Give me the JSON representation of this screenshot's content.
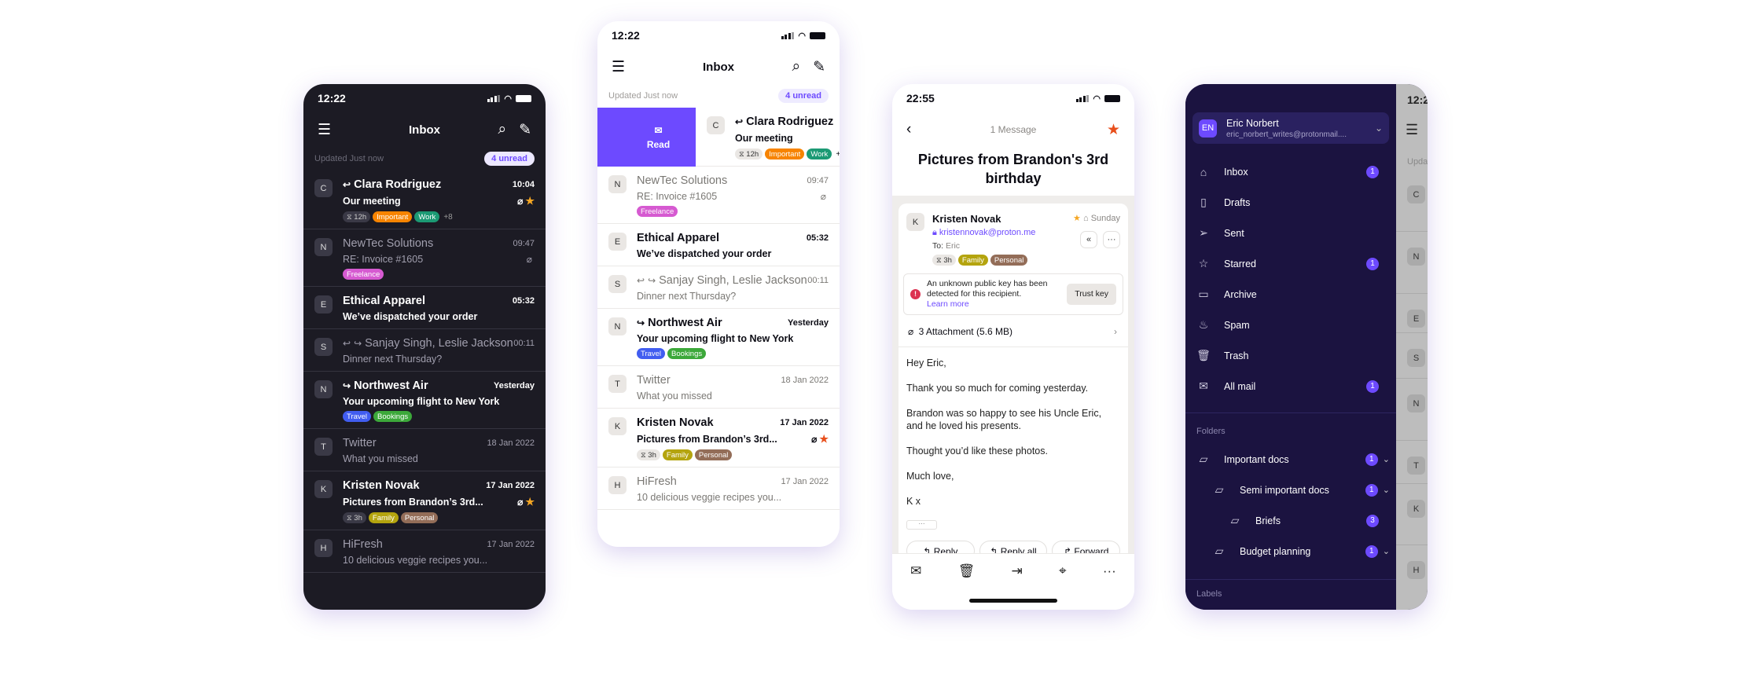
{
  "colors": {
    "accent": "#6d4aff",
    "dark_bg": "#1c1b24",
    "sidebar_bg": "#1b1340",
    "star_light": "#e84f1c",
    "star_dark": "#f5a623"
  },
  "status": {
    "time_inbox": "12:22",
    "time_message": "22:55",
    "time_partial": "12:2"
  },
  "inbox": {
    "title": "Inbox",
    "updated": "Updated Just now",
    "unread": "4 unread",
    "icons": {
      "menu": "hamburger-icon",
      "search": "search-icon",
      "compose": "compose-icon"
    },
    "swipe_action": {
      "label": "Read",
      "icon": "envelope-open-icon"
    },
    "rows": [
      {
        "initial": "C",
        "sender": "Clara Rodriguez",
        "subject": "Our meeting",
        "time": "10:04",
        "unread": true,
        "replied": true,
        "forwarded": false,
        "attachment": true,
        "starred": true,
        "expiry": "12h",
        "tags": [
          {
            "label": "Important",
            "color": "#f78400"
          },
          {
            "label": "Work",
            "color": "#1c9a74"
          }
        ],
        "more": "+8"
      },
      {
        "initial": "N",
        "sender": "NewTec Solutions",
        "subject": "RE: Invoice #1605",
        "time": "09:47",
        "unread": false,
        "replied": false,
        "forwarded": false,
        "attachment": true,
        "starred": false,
        "expiry": "",
        "tags": [
          {
            "label": "Freelance",
            "color": "#d65ad1"
          }
        ],
        "more": ""
      },
      {
        "initial": "E",
        "sender": "Ethical Apparel",
        "subject": "We’ve dispatched your order",
        "time": "05:32",
        "unread": true,
        "replied": false,
        "forwarded": false,
        "attachment": false,
        "starred": false,
        "expiry": "",
        "tags": [],
        "more": ""
      },
      {
        "initial": "S",
        "sender": "Sanjay Singh, Leslie Jackson",
        "subject": "Dinner next Thursday?",
        "time": "00:11",
        "unread": false,
        "replied": true,
        "forwarded": true,
        "attachment": false,
        "starred": false,
        "expiry": "",
        "tags": [],
        "more": ""
      },
      {
        "initial": "N",
        "sender": "Northwest Air",
        "subject": "Your upcoming flight to New York",
        "time": "Yesterday",
        "unread": true,
        "replied": false,
        "forwarded": true,
        "attachment": false,
        "starred": false,
        "expiry": "",
        "tags": [
          {
            "label": "Travel",
            "color": "#415df0"
          },
          {
            "label": "Bookings",
            "color": "#3ca83a"
          }
        ],
        "more": ""
      },
      {
        "initial": "T",
        "sender": "Twitter",
        "subject": "What you missed",
        "time": "18 Jan 2022",
        "unread": false,
        "replied": false,
        "forwarded": false,
        "attachment": false,
        "starred": false,
        "expiry": "",
        "tags": [],
        "more": ""
      },
      {
        "initial": "K",
        "sender": "Kristen Novak",
        "subject": "Pictures from Brandon’s 3rd...",
        "time": "17 Jan 2022",
        "unread": true,
        "replied": false,
        "forwarded": false,
        "attachment": true,
        "starred": true,
        "expiry": "3h",
        "tags": [
          {
            "label": "Family",
            "color": "#b4a40e"
          },
          {
            "label": "Personal",
            "color": "#936d58"
          }
        ],
        "more": ""
      },
      {
        "initial": "H",
        "sender": "HiFresh",
        "subject": "10 delicious veggie recipes you...",
        "time": "17 Jan 2022",
        "unread": false,
        "replied": false,
        "forwarded": false,
        "attachment": false,
        "starred": false,
        "expiry": "",
        "tags": [],
        "more": ""
      }
    ]
  },
  "message": {
    "count": "1 Message",
    "title": "Pictures from Brandon's 3rd birthday",
    "sender_initial": "K",
    "sender": "Kristen Novak",
    "email": "kristennovak@proton.me",
    "to_label": "To:",
    "to": "Eric",
    "date": "Sunday",
    "expiry": "3h",
    "tags": [
      {
        "label": "Family",
        "color": "#b4a40e"
      },
      {
        "label": "Personal",
        "color": "#936d58"
      }
    ],
    "warning": "An unknown public key has been detected for this recipient.",
    "learn_more": "Learn more",
    "trust_key": "Trust key",
    "attachments": "3 Attachment (5.6 MB)",
    "body": [
      "Hey Eric,",
      "Thank you so much for coming yesterday.",
      "Brandon was so happy to see his Uncle Eric,\nand he loved his presents.",
      "Thought you’d like these photos.",
      "Much love,",
      "K x"
    ],
    "actions": {
      "reply": "Reply",
      "reply_all": "Reply all",
      "forward": "Forward"
    }
  },
  "sidebar": {
    "account": {
      "initials": "EN",
      "name": "Eric Norbert",
      "email": "eric_norbert_writes@protonmail...."
    },
    "items": [
      {
        "label": "Inbox",
        "icon": "inbox-icon",
        "badge": "1"
      },
      {
        "label": "Drafts",
        "icon": "draft-icon",
        "badge": ""
      },
      {
        "label": "Sent",
        "icon": "send-icon",
        "badge": ""
      },
      {
        "label": "Starred",
        "icon": "star-icon",
        "badge": "1"
      },
      {
        "label": "Archive",
        "icon": "archive-icon",
        "badge": ""
      },
      {
        "label": "Spam",
        "icon": "fire-icon",
        "badge": ""
      },
      {
        "label": "Trash",
        "icon": "trash-icon",
        "badge": ""
      },
      {
        "label": "All mail",
        "icon": "all-mail-icon",
        "badge": "1"
      }
    ],
    "folders_label": "Folders",
    "folders": [
      {
        "label": "Important docs",
        "badge": "1",
        "level": 0,
        "expandable": true
      },
      {
        "label": "Semi important docs",
        "badge": "1",
        "level": 1,
        "expandable": true
      },
      {
        "label": "Briefs",
        "badge": "3",
        "level": 2,
        "expandable": false
      },
      {
        "label": "Budget planning",
        "badge": "1",
        "level": 1,
        "expandable": true
      }
    ],
    "labels_label": "Labels",
    "behind": {
      "updated": "Upda",
      "initials": [
        "C",
        "N",
        "E",
        "S",
        "N",
        "T",
        "K",
        "H"
      ]
    }
  }
}
